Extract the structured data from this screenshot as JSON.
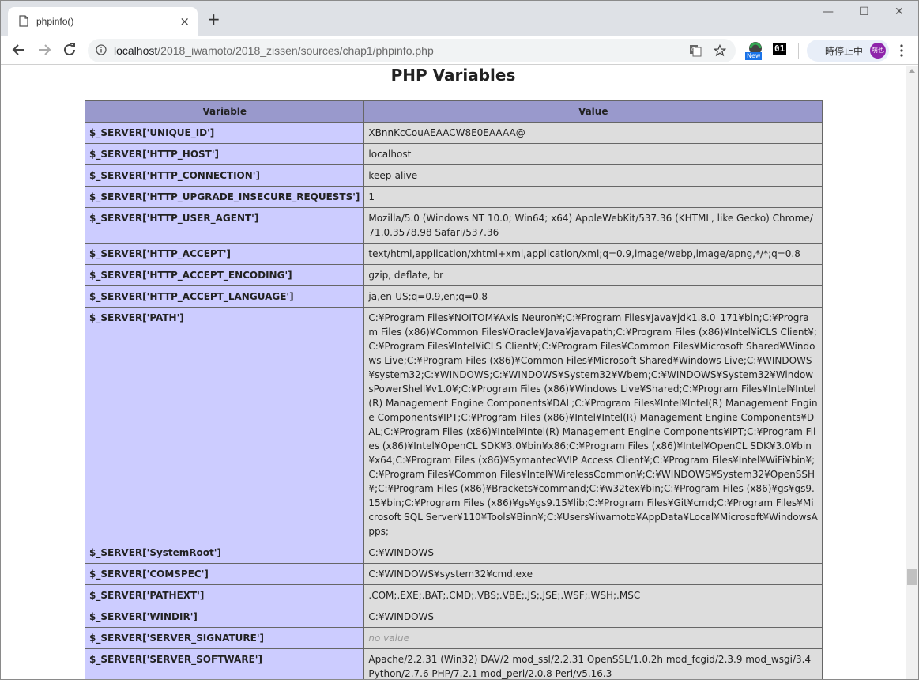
{
  "browser": {
    "tab_title": "phpinfo()",
    "tab_close": "×",
    "new_tab": "+",
    "window_controls": {
      "minimize": "—",
      "maximize": "☐",
      "close": "✕"
    },
    "url_host": "localhost",
    "url_path": "/2018_iwamoto/2018_zissen/sources/chap1/phpinfo.php",
    "ext_new_badge": "New",
    "ext_01_label": "01",
    "pause_label": "一時停止中",
    "avatar_text": "萌也",
    "icons": [
      "back-icon",
      "forward-icon",
      "reload-icon",
      "info-icon",
      "translate-icon",
      "star-icon",
      "extension-icon",
      "menu-icon"
    ]
  },
  "page": {
    "heading": "PHP Variables",
    "columns": [
      "Variable",
      "Value"
    ],
    "rows": [
      {
        "var": "$_SERVER['UNIQUE_ID']",
        "value": "XBnnKcCouAEAACW8E0EAAAA@"
      },
      {
        "var": "$_SERVER['HTTP_HOST']",
        "value": "localhost"
      },
      {
        "var": "$_SERVER['HTTP_CONNECTION']",
        "value": "keep-alive"
      },
      {
        "var": "$_SERVER['HTTP_UPGRADE_INSECURE_REQUESTS']",
        "value": "1"
      },
      {
        "var": "$_SERVER['HTTP_USER_AGENT']",
        "value": "Mozilla/5.0 (Windows NT 10.0; Win64; x64) AppleWebKit/537.36 (KHTML, like Gecko) Chrome/71.0.3578.98 Safari/537.36"
      },
      {
        "var": "$_SERVER['HTTP_ACCEPT']",
        "value": "text/html,application/xhtml+xml,application/xml;q=0.9,image/webp,image/apng,*/*;q=0.8"
      },
      {
        "var": "$_SERVER['HTTP_ACCEPT_ENCODING']",
        "value": "gzip, deflate, br"
      },
      {
        "var": "$_SERVER['HTTP_ACCEPT_LANGUAGE']",
        "value": "ja,en-US;q=0.9,en;q=0.8"
      },
      {
        "var": "$_SERVER['PATH']",
        "value": "C:¥Program Files¥NOITOM¥Axis Neuron¥;C:¥Program Files¥Java¥jdk1.8.0_171¥bin;C:¥Program Files (x86)¥Common Files¥Oracle¥Java¥javapath;C:¥Program Files (x86)¥Intel¥iCLS Client¥;C:¥Program Files¥Intel¥iCLS Client¥;C:¥Program Files¥Common Files¥Microsoft Shared¥Windows Live;C:¥Program Files (x86)¥Common Files¥Microsoft Shared¥Windows Live;C:¥WINDOWS¥system32;C:¥WINDOWS;C:¥WINDOWS¥System32¥Wbem;C:¥WINDOWS¥System32¥WindowsPowerShell¥v1.0¥;C:¥Program Files (x86)¥Windows Live¥Shared;C:¥Program Files¥Intel¥Intel(R) Management Engine Components¥DAL;C:¥Program Files¥Intel¥Intel(R) Management Engine Components¥IPT;C:¥Program Files (x86)¥Intel¥Intel(R) Management Engine Components¥DAL;C:¥Program Files (x86)¥Intel¥Intel(R) Management Engine Components¥IPT;C:¥Program Files (x86)¥Intel¥OpenCL SDK¥3.0¥bin¥x86;C:¥Program Files (x86)¥Intel¥OpenCL SDK¥3.0¥bin¥x64;C:¥Program Files (x86)¥Symantec¥VIP Access Client¥;C:¥Program Files¥Intel¥WiFi¥bin¥;C:¥Program Files¥Common Files¥Intel¥WirelessCommon¥;C:¥WINDOWS¥System32¥OpenSSH¥;C:¥Program Files (x86)¥Brackets¥command;C:¥w32tex¥bin;C:¥Program Files (x86)¥gs¥gs9.15¥bin;C:¥Program Files (x86)¥gs¥gs9.15¥lib;C:¥Program Files¥Git¥cmd;C:¥Program Files¥Microsoft SQL Server¥110¥Tools¥Binn¥;C:¥Users¥iwamoto¥AppData¥Local¥Microsoft¥WindowsApps;"
      },
      {
        "var": "$_SERVER['SystemRoot']",
        "value": "C:¥WINDOWS"
      },
      {
        "var": "$_SERVER['COMSPEC']",
        "value": "C:¥WINDOWS¥system32¥cmd.exe"
      },
      {
        "var": "$_SERVER['PATHEXT']",
        "value": ".COM;.EXE;.BAT;.CMD;.VBS;.VBE;.JS;.JSE;.WSF;.WSH;.MSC"
      },
      {
        "var": "$_SERVER['WINDIR']",
        "value": "C:¥WINDOWS"
      },
      {
        "var": "$_SERVER['SERVER_SIGNATURE']",
        "value": "no value",
        "novalue": true
      },
      {
        "var": "$_SERVER['SERVER_SOFTWARE']",
        "value": "Apache/2.2.31 (Win32) DAV/2 mod_ssl/2.2.31 OpenSSL/1.0.2h mod_fcgid/2.3.9 mod_wsgi/3.4 Python/2.7.6 PHP/7.2.1 mod_perl/2.0.8 Perl/v5.16.3"
      }
    ]
  }
}
